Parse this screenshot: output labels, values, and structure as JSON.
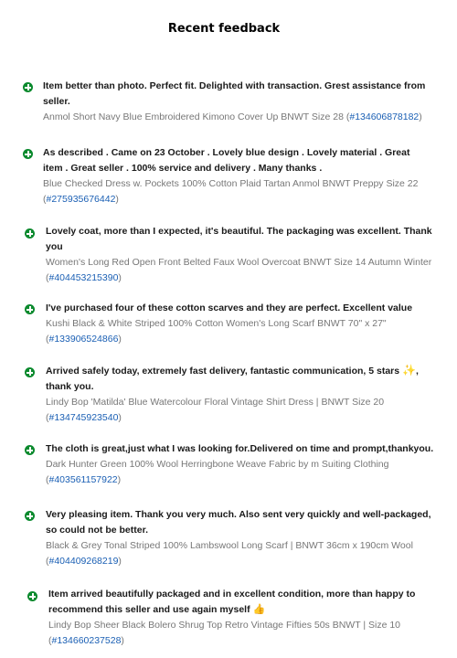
{
  "page": {
    "title": "Recent feedback"
  },
  "feedback": [
    {
      "comment": "Item better than photo. Perfect fit. Delighted with transaction. Grest assistance from seller.",
      "item_text": "Anmol Short Navy Blue Embroidered Kimono Cover Up BNWT Size 28 (",
      "item_id": "#134606878182",
      "close": ")"
    },
    {
      "comment": "As described . Came on 23 October . Lovely blue design . Lovely material . Great item . Great seller . 100% service and delivery . Many thanks .",
      "item_text": "Blue Checked Dress w. Pockets 100% Cotton Plaid Tartan Anmol BNWT Preppy Size 22 (",
      "item_id": "#275935676442",
      "close": ")"
    },
    {
      "comment": "Lovely coat, more than I expected, it's beautiful. The packaging was excellent. Thank you",
      "item_text": "Women's Long Red Open Front Belted Faux Wool Overcoat BNWT Size 14 Autumn Winter (",
      "item_id": "#404453215390",
      "close": ")"
    },
    {
      "comment": "I've purchased four of these cotton scarves and they are perfect. Excellent value",
      "item_text": "Kushi Black & White Striped 100% Cotton Women's Long Scarf BNWT 70\" x 27\" (",
      "item_id": "#133906524866",
      "close": ")"
    },
    {
      "comment": "Arrived safely today, extremely fast delivery, fantastic communication, 5 stars",
      "comment_emoji": "✨",
      "comment_tail": ", thank you.",
      "item_text": "Lindy Bop 'Matilda' Blue Watercolour Floral Vintage Shirt Dress | BNWT Size 20 (",
      "item_id": "#134745923540",
      "close": ")"
    },
    {
      "comment": "The cloth is great,just what I was looking for.Delivered on time and prompt,thankyou.",
      "item_text": "Dark Hunter Green 100% Wool Herringbone Weave Fabric by m Suiting Clothing (",
      "item_id": "#403561157922",
      "close": ")"
    },
    {
      "comment": "Very pleasing item. Thank you very much. Also sent very quickly and well-packaged, so could not be better.",
      "item_text": "Black & Grey Tonal Striped 100% Lambswool Long Scarf | BNWT 36cm x 190cm Wool (",
      "item_id": "#404409268219",
      "close": ")"
    },
    {
      "comment": "Item arrived beautifully packaged and in excellent condition, more than happy to recommend this seller and use again myself",
      "comment_emoji": "👍",
      "item_text": "Lindy Bop Sheer Black Bolero Shrug Top Retro Vintage Fifties 50s BNWT | Size 10 (",
      "item_id": "#134660237528",
      "close": ")"
    }
  ]
}
